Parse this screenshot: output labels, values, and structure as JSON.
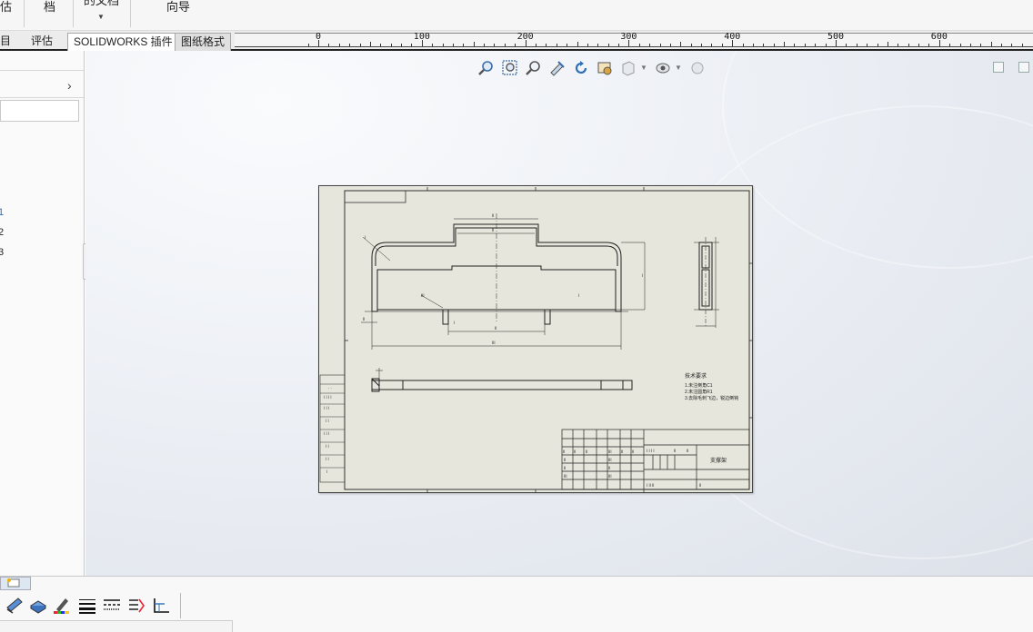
{
  "ribbon": {
    "labels": [
      "估",
      "档",
      "的文档",
      "向导"
    ]
  },
  "tabs": {
    "items": [
      {
        "label": "目",
        "state": "normal"
      },
      {
        "label": "评估",
        "state": "normal"
      },
      {
        "label": "SOLIDWORKS 插件",
        "state": "active"
      },
      {
        "label": "图纸格式",
        "state": "dark"
      }
    ]
  },
  "ruler": {
    "labels": [
      "0",
      "100",
      "200",
      "300",
      "400",
      "500",
      "600"
    ]
  },
  "left_panel": {
    "numbers": [
      "1",
      "2",
      "3"
    ]
  },
  "heads_up_toolbar": {
    "icons": [
      "zoom-to-fit-icon",
      "zoom-to-area-icon",
      "zoom-in-out-icon",
      "pan-icon",
      "rotate-icon",
      "display-style-icon",
      "view-orientation-icon",
      "hide-show-icon",
      "appearance-icon"
    ]
  },
  "sheet": {
    "tech_requirements": {
      "title": "技术要求",
      "lines": [
        "1.未注倒角C1",
        "2.未注圆角R1",
        "3.去除毛刺飞边，锐边倒钝"
      ]
    },
    "title_block": {
      "part_name": "支撑架"
    }
  },
  "bottom_toolbar": {
    "icons": [
      "smart-dimension-icon",
      "model-items-icon",
      "line-format-icon",
      "line-thickness-icon",
      "line-style-icon",
      "layer-icon",
      "baseline-dimension-icon"
    ]
  },
  "colors": {
    "sheet_bg": "#e6e6dc",
    "viewport_bg": "#eef1f6",
    "accent_blue": "#2f6fb5"
  }
}
